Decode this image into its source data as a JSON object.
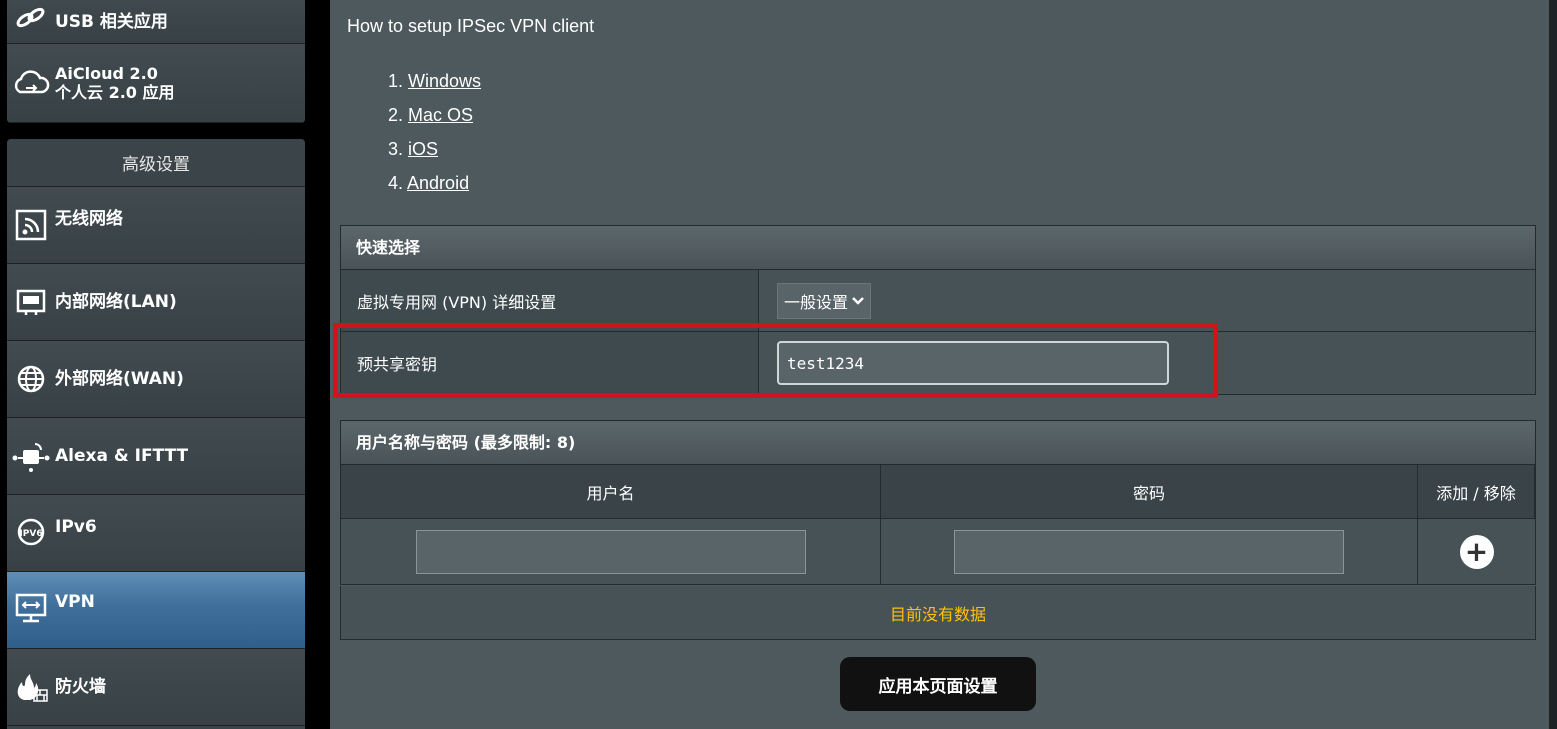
{
  "sidebar": {
    "top_items": [
      {
        "label": "USB 相关应用",
        "icon": "usb-icon"
      },
      {
        "label_line1": "AiCloud 2.0",
        "label_line2": "个人云 2.0 应用",
        "icon": "cloud-icon"
      }
    ],
    "advanced_header": "高级设置",
    "items": [
      {
        "label": "无线网络",
        "icon": "wireless-icon"
      },
      {
        "label": "内部网络(LAN)",
        "icon": "lan-icon"
      },
      {
        "label": "外部网络(WAN)",
        "icon": "globe-icon"
      },
      {
        "label": "Alexa & IFTTT",
        "icon": "alexa-icon"
      },
      {
        "label": "IPv6",
        "icon": "ipv6-icon"
      },
      {
        "label": "VPN",
        "icon": "vpn-icon",
        "active": true
      },
      {
        "label": "防火墙",
        "icon": "firewall-icon"
      }
    ]
  },
  "main": {
    "howto_title": "How to setup IPSec VPN client",
    "clients": [
      {
        "num": "1.",
        "label": "Windows"
      },
      {
        "num": "2.",
        "label": "Mac OS"
      },
      {
        "num": "3.",
        "label": "iOS"
      },
      {
        "num": "4.",
        "label": "Android"
      }
    ],
    "quick_select": {
      "header": "快速选择",
      "vpn_label": "虚拟专用网 (VPN) 详细设置",
      "vpn_value": "一般设置",
      "psk_label": "预共享密钥",
      "psk_value": "test1234"
    },
    "users": {
      "header": "用户名称与密码 (最多限制: 8)",
      "col_username": "用户名",
      "col_password": "密码",
      "col_action": "添加 / 移除",
      "empty_text": "目前没有数据"
    },
    "apply_label": "应用本页面设置"
  },
  "colors": {
    "highlight": "#d2121c",
    "no_data": "#ffc107",
    "active_item": "#3f6f9a"
  }
}
